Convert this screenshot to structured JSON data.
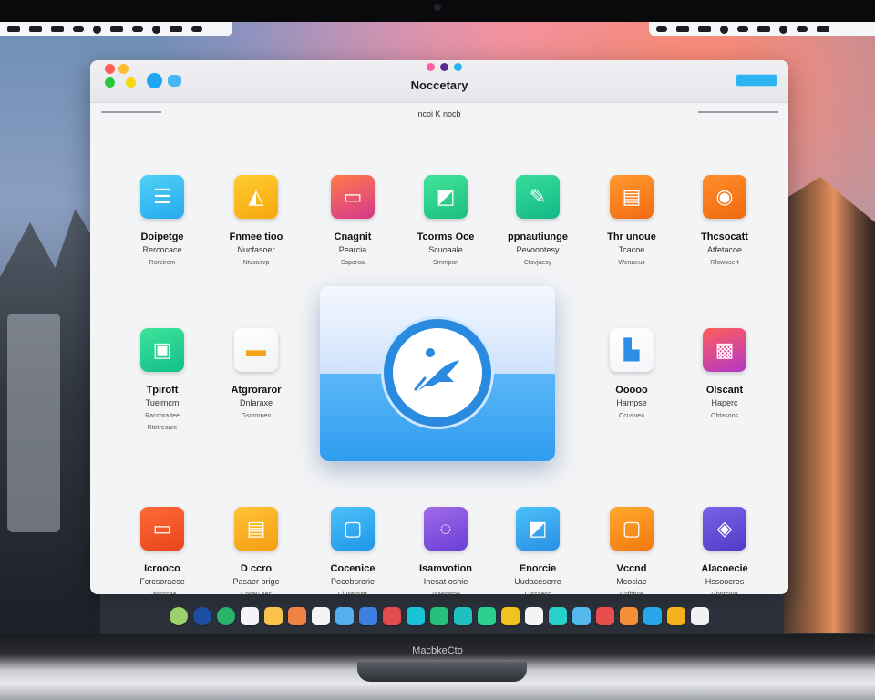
{
  "window": {
    "title": "Noccetary",
    "breadcrumb": "ncoi K nocb"
  },
  "apps": [
    {
      "name": "Doipetge",
      "subtitle": "Rercocace",
      "meta": "Rorcirem",
      "icon": "list-icon",
      "color_from": "#4fd1f6",
      "color_to": "#27a9ee"
    },
    {
      "name": "Fnmee tioo",
      "subtitle": "Nucfasoer",
      "meta": "Ntvsosvp",
      "icon": "chart-icon",
      "color_from": "#ffcc33",
      "color_to": "#f7a70b"
    },
    {
      "name": "Cnagnit",
      "subtitle": "Pearcia",
      "meta": "Ssporoa",
      "icon": "folder-icon",
      "color_from": "#ff7b4a",
      "color_to": "#d6378c"
    },
    {
      "name": "Tcorms Oce",
      "subtitle": "Scuoaale",
      "meta": "Srnmpsn",
      "icon": "graph-icon",
      "color_from": "#43e49a",
      "color_to": "#1bbf7e"
    },
    {
      "name": "ppnautiunge",
      "subtitle": "Pevoootesy",
      "meta": "Ctsvjaesy",
      "icon": "edit-icon",
      "color_from": "#38dd9b",
      "color_to": "#12b986"
    },
    {
      "name": "Thr unoue",
      "subtitle": "Tcacoe",
      "meta": "Wcnaeus",
      "icon": "docs-icon",
      "color_from": "#ff9b30",
      "color_to": "#f46a12"
    },
    {
      "name": "Thcsocatt",
      "subtitle": "Atfetacoe",
      "meta": "Rfowocert",
      "icon": "compass-icon",
      "color_from": "#ff8d2a",
      "color_to": "#f06a10"
    },
    {
      "name": "Tpiroft",
      "subtitle": "Tueimcm",
      "meta": "Raccora tee",
      "extra": "Rtotresare",
      "icon": "chat-icon",
      "color_from": "#3ee39a",
      "color_to": "#12be8a"
    },
    {
      "name": "Atgroraror",
      "subtitle": "Dnlaraxe",
      "meta": "Gscroroeo",
      "icon": "cards-icon",
      "color_from": "#ffffff",
      "color_to": "#f1f2f5"
    },
    {
      "name": "Ooooo",
      "subtitle": "Hampse",
      "meta": "Ocusoea",
      "icon": "bar-icon",
      "color_from": "#ffffff",
      "color_to": "#f3f5f8"
    },
    {
      "name": "Olscant",
      "subtitle": "Haperc",
      "meta": "Ohtasoos",
      "icon": "image-icon",
      "color_from": "#ff5f5a",
      "color_to": "#b436c8"
    },
    {
      "name": "Icrooco",
      "subtitle": "Fcrcsoraese",
      "meta": "Caimccae",
      "icon": "wallet-icon",
      "color_from": "#ff6a37",
      "color_to": "#e8451c"
    },
    {
      "name": "D ccro",
      "subtitle": "Pasaer brige",
      "meta": "Cooeu aes",
      "icon": "note-icon",
      "color_from": "#ffc338",
      "color_to": "#f59d12"
    },
    {
      "name": "Cocenice",
      "subtitle": "Pecebsrerie",
      "meta": "Cjusernatr",
      "icon": "window-icon",
      "color_from": "#4cc1f7",
      "color_to": "#1f96ea"
    },
    {
      "name": "Isamvotion",
      "subtitle": "Inesat oshie",
      "meta": "Tcaesatoe",
      "icon": "sync-icon",
      "color_from": "#a06be8",
      "color_to": "#6b3fd6"
    },
    {
      "name": "Enorcie",
      "subtitle": "Uudaceserre",
      "meta": "Ctscaesc",
      "icon": "graph-icon",
      "color_from": "#4cc1f7",
      "color_to": "#2a8fe6"
    },
    {
      "name": "Vccnd",
      "subtitle": "Mcociae",
      "meta": "Ccfbbce",
      "icon": "frame-icon",
      "color_from": "#ffaa2e",
      "color_to": "#f4790d"
    },
    {
      "name": "Alacoecie",
      "subtitle": "Hssoocros",
      "meta": "Gbprcore",
      "icon": "badge-icon",
      "color_from": "#7a62e8",
      "color_to": "#4f3cc7"
    }
  ],
  "feature": {
    "icon": "rocket-icon"
  },
  "dock": {
    "colors": [
      "#9ad16a",
      "#1b4fa3",
      "#2ab36a",
      "#f4f4f6",
      "#f9c34c",
      "#f08244",
      "#f4f4f6",
      "#55aef0",
      "#3c7fe0",
      "#e24b4b",
      "#19c3d6",
      "#25c07a",
      "#1fbfc2",
      "#2bd08e",
      "#f2c31f",
      "#f4f4f6",
      "#25d1c9",
      "#54b8ef",
      "#e84e4e",
      "#f39038",
      "#27a7e8",
      "#f6b21c",
      "#f1f1f3"
    ]
  },
  "brand": "MacbkeCto"
}
